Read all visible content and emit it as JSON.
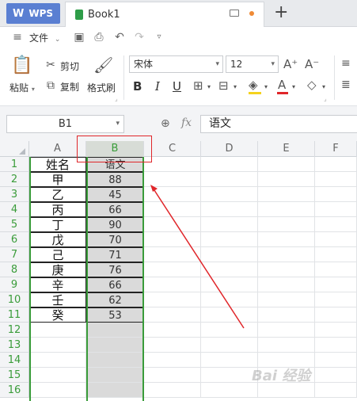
{
  "titlebar": {
    "app_label": "WPS",
    "doc_tab": "Book1"
  },
  "quickbar": {
    "file_label": "文件"
  },
  "ribbon": {
    "paste_label": "粘贴",
    "cut_label": "剪切",
    "copy_label": "复制",
    "format_painter_label": "格式刷",
    "font_name": "宋体",
    "font_size": "12"
  },
  "formula": {
    "name_box": "B1",
    "fx_label": "fx",
    "content": "语文"
  },
  "grid": {
    "columns": [
      "A",
      "B",
      "C",
      "D",
      "E",
      "F"
    ],
    "rows": [
      "1",
      "2",
      "3",
      "4",
      "5",
      "6",
      "7",
      "8",
      "9",
      "10",
      "11",
      "12",
      "13",
      "14",
      "15",
      "16"
    ],
    "col_a": [
      "姓名",
      "甲",
      "乙",
      "丙",
      "丁",
      "戊",
      "己",
      "庚",
      "辛",
      "壬",
      "癸"
    ],
    "col_b": [
      "语文",
      "88",
      "45",
      "66",
      "90",
      "70",
      "71",
      "76",
      "66",
      "62",
      "53"
    ]
  },
  "colors": {
    "accent_green": "#3a9c3a",
    "annotation_red": "#e0262a",
    "wps_blue": "#5a7fd2"
  }
}
